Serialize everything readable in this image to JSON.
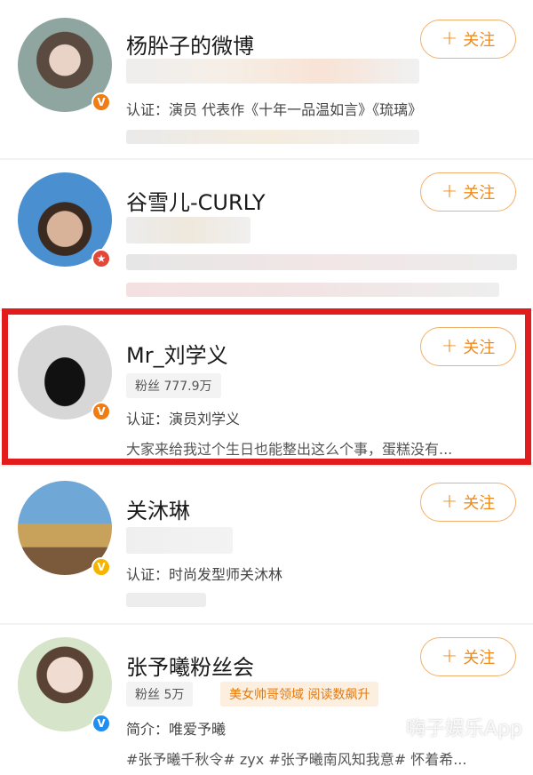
{
  "follow_label": "关注",
  "follow_icon": "plus-icon",
  "accent_color": "#f08a1a",
  "highlight_color": "#e21c1c",
  "users": [
    {
      "name": "杨肸子的微博",
      "verified": "v-orange",
      "auth": "认证：演员 代表作《十年一品温如言》《琉璃》"
    },
    {
      "name": "谷雪儿-CURLY",
      "verified": "star-red"
    },
    {
      "name": "Mr_刘学义",
      "verified": "v-orange",
      "fans": "粉丝 777.9万",
      "auth": "认证：演员刘学义",
      "desc": "大家来给我过个生日也能整出这么个事，蛋糕没有..."
    },
    {
      "name": "关沐琳",
      "verified": "v-yellow",
      "auth": "认证：时尚发型师关沐林"
    },
    {
      "name": "张予曦粉丝会",
      "verified": "v-blue",
      "fans": "粉丝 5万",
      "tag": "美女帅哥领域 阅读数飙升",
      "intro": "简介：唯爱予曦",
      "topics": "#张予曦千秋令# zyx #张予曦南风知我意# 怀着希..."
    }
  ],
  "watermark": "嗨子娱乐App"
}
